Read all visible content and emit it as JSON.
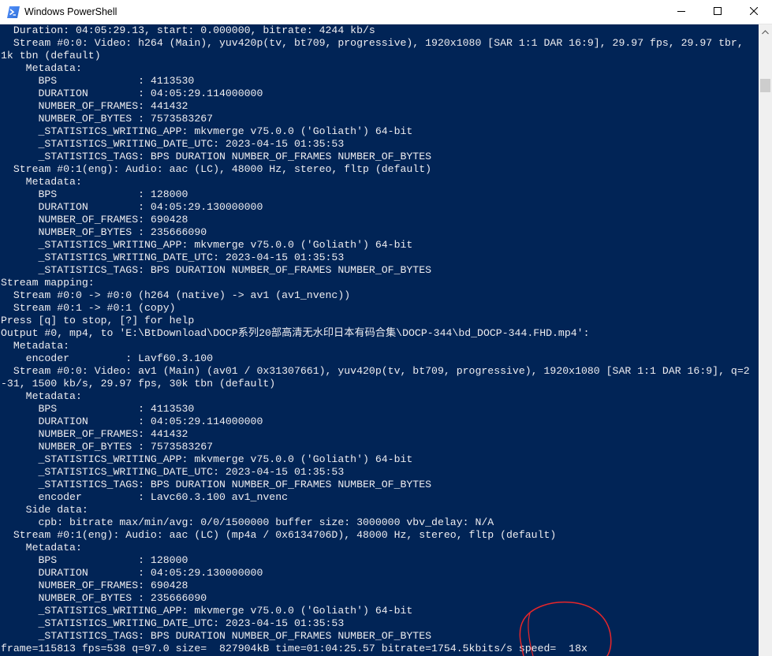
{
  "window": {
    "title": "Windows PowerShell",
    "icon": "powershell-icon"
  },
  "caption_buttons": {
    "minimize_icon": "minimize-icon",
    "maximize_icon": "maximize-icon",
    "close_icon": "close-icon"
  },
  "colors": {
    "console_background": "#012456",
    "console_text": "#eeedf0",
    "annotation": "#e8262a"
  },
  "console": {
    "lines": [
      "  Duration: 04:05:29.13, start: 0.000000, bitrate: 4244 kb/s",
      "  Stream #0:0: Video: h264 (Main), yuv420p(tv, bt709, progressive), 1920x1080 [SAR 1:1 DAR 16:9], 29.97 fps, 29.97 tbr,",
      "1k tbn (default)",
      "    Metadata:",
      "      BPS             : 4113530",
      "      DURATION        : 04:05:29.114000000",
      "      NUMBER_OF_FRAMES: 441432",
      "      NUMBER_OF_BYTES : 7573583267",
      "      _STATISTICS_WRITING_APP: mkvmerge v75.0.0 ('Goliath') 64-bit",
      "      _STATISTICS_WRITING_DATE_UTC: 2023-04-15 01:35:53",
      "      _STATISTICS_TAGS: BPS DURATION NUMBER_OF_FRAMES NUMBER_OF_BYTES",
      "  Stream #0:1(eng): Audio: aac (LC), 48000 Hz, stereo, fltp (default)",
      "    Metadata:",
      "      BPS             : 128000",
      "      DURATION        : 04:05:29.130000000",
      "      NUMBER_OF_FRAMES: 690428",
      "      NUMBER_OF_BYTES : 235666090",
      "      _STATISTICS_WRITING_APP: mkvmerge v75.0.0 ('Goliath') 64-bit",
      "      _STATISTICS_WRITING_DATE_UTC: 2023-04-15 01:35:53",
      "      _STATISTICS_TAGS: BPS DURATION NUMBER_OF_FRAMES NUMBER_OF_BYTES",
      "Stream mapping:",
      "  Stream #0:0 -> #0:0 (h264 (native) -> av1 (av1_nvenc))",
      "  Stream #0:1 -> #0:1 (copy)",
      "Press [q] to stop, [?] for help",
      "Output #0, mp4, to 'E:\\BtDownload\\DOCP系列20部高清无水印日本有码合集\\DOCP-344\\bd_DOCP-344.FHD.mp4':",
      "  Metadata:",
      "    encoder         : Lavf60.3.100",
      "  Stream #0:0: Video: av1 (Main) (av01 / 0x31307661), yuv420p(tv, bt709, progressive), 1920x1080 [SAR 1:1 DAR 16:9], q=2",
      "-31, 1500 kb/s, 29.97 fps, 30k tbn (default)",
      "    Metadata:",
      "      BPS             : 4113530",
      "      DURATION        : 04:05:29.114000000",
      "      NUMBER_OF_FRAMES: 441432",
      "      NUMBER_OF_BYTES : 7573583267",
      "      _STATISTICS_WRITING_APP: mkvmerge v75.0.0 ('Goliath') 64-bit",
      "      _STATISTICS_WRITING_DATE_UTC: 2023-04-15 01:35:53",
      "      _STATISTICS_TAGS: BPS DURATION NUMBER_OF_FRAMES NUMBER_OF_BYTES",
      "      encoder         : Lavc60.3.100 av1_nvenc",
      "    Side data:",
      "      cpb: bitrate max/min/avg: 0/0/1500000 buffer size: 3000000 vbv_delay: N/A",
      "  Stream #0:1(eng): Audio: aac (LC) (mp4a / 0x6134706D), 48000 Hz, stereo, fltp (default)",
      "    Metadata:",
      "      BPS             : 128000",
      "      DURATION        : 04:05:29.130000000",
      "      NUMBER_OF_FRAMES: 690428",
      "      NUMBER_OF_BYTES : 235666090",
      "      _STATISTICS_WRITING_APP: mkvmerge v75.0.0 ('Goliath') 64-bit",
      "      _STATISTICS_WRITING_DATE_UTC: 2023-04-15 01:35:53",
      "      _STATISTICS_TAGS: BPS DURATION NUMBER_OF_FRAMES NUMBER_OF_BYTES",
      "frame=115813 fps=538 q=97.0 size=  827904kB time=01:04:25.57 bitrate=1754.5kbits/s speed=  18x"
    ]
  },
  "scrollbar": {
    "up_arrow_icon": "chevron-up-icon"
  },
  "annotation": {
    "shape": "hand-drawn-circle",
    "target": "speed"
  }
}
